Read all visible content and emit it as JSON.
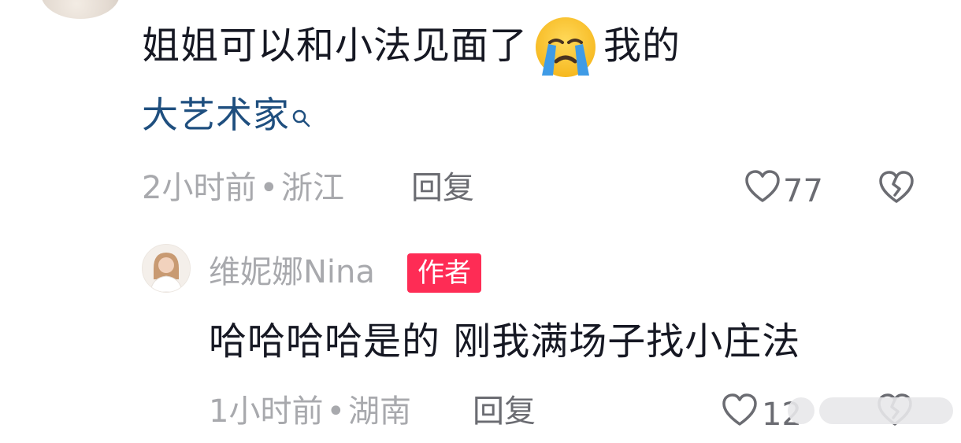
{
  "comment": {
    "text_part1": "姐姐可以和小法见面了",
    "emoji": "crying-face-emoji",
    "text_part2": "我的",
    "topic_link": "大艺术家",
    "time": "2小时前",
    "separator": "•",
    "location": "浙江",
    "reply_label": "回复",
    "like_count": "77"
  },
  "reply": {
    "author_name": "维妮娜Nina",
    "author_badge": "作者",
    "text": "哈哈哈哈是的 刚我满场子找小庄法",
    "time": "1小时前",
    "separator": "•",
    "location": "湖南",
    "reply_label": "回复",
    "like_count": "12"
  },
  "colors": {
    "text": "#161823",
    "meta": "#a8a9ad",
    "link": "#1f4f7f",
    "badge": "#fe2c55"
  }
}
